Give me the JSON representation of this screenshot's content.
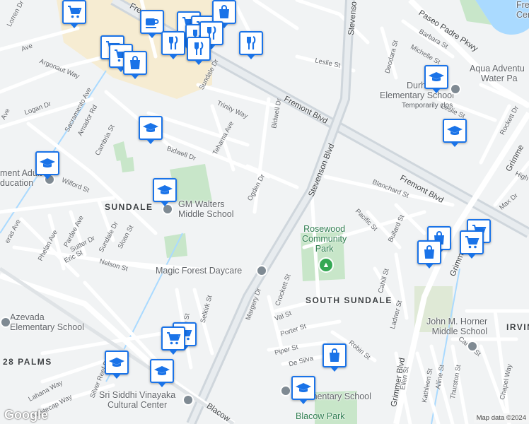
{
  "neighborhoods": {
    "sundale": "SUNDALE",
    "south_sundale": "SOUTH SUNDALE",
    "twenty_eight_palms": "28 PALMS",
    "irvington": "IRVIN"
  },
  "roads": {
    "fremont_blvd_1": "Fremont Blvd",
    "fremont_blvd_2": "Fremont Blvd",
    "fremont_blvd_top": "Fremo",
    "stevenson_blvd": "Stevenson Blvd",
    "stevenson_top": "Stevenso",
    "paseo_padre": "Paseo Padre Pkwy",
    "grimmer_blvd": "Grimmer Blvd",
    "grimmer_bottom": "Grimmer Blvd",
    "grimmer_top": "Grimme",
    "blacow": "Blacow",
    "argonaut": "Argonaut Way",
    "sacramento": "Sacramento Ave",
    "logan": "Logan Dr",
    "amador": "Amador Rd",
    "cambria": "Cambria St",
    "bidwell_dr": "Bidwell Dr",
    "bidwell_dr_2": "Bidwell Dr",
    "tehama": "Tehama Ave",
    "trinity": "Trinity Way",
    "sundale_dr_top": "Sundale Dr",
    "sundale_dr": "Sundale Dr",
    "ogden": "Ogden Dr",
    "wilford": "Wilford St",
    "pardee": "Pardee Ave",
    "phelan": "Phelan Ave",
    "sutter": "Sutter Dr",
    "eric": "Eric St",
    "sloan": "Sloan St",
    "nelson": "Nelson St",
    "alvarado": "eras Ave",
    "lorren": "Lorren Dr",
    "a_ave": "Ave",
    "leslie_top": "Leslie St",
    "leslie_right": "Leslie St",
    "barbara": "Barbara St",
    "michelle": "Michelle St",
    "deodara": "Deodara St",
    "rockett": "Rockett Dr",
    "high": "High",
    "max": "Max Dr",
    "blanchard": "Blanchard St",
    "pacific": "Pacific St",
    "bullard": "Bullard St",
    "cahill": "Cahill St",
    "ladner": "Ladner St",
    "margery": "Margery Dr",
    "crockett": "Crockett St",
    "val": "Val St",
    "porter": "Porter St",
    "piper": "Piper St",
    "de_silva": "De Silva",
    "robin": "Robin St",
    "caren": "Caren St",
    "thurston": "Thurston St",
    "alline": "Alline St",
    "kathleen": "Kathleen St",
    "ellen": "Ellen St",
    "chapel": "Chapel Way",
    "lahana": "Lahana Way",
    "whitecap": "Whitecap Way",
    "silver_reef": "Silver Reef Dr",
    "sidbarh": "Sidbarh St",
    "selkirk": "Selkirk St"
  },
  "places": {
    "walters": "GM Walters\nMiddle School",
    "magic_forest": "Magic Forest Daycare",
    "rosewood": "Rosewood\nCommunity\nPark",
    "durham": "Durh",
    "durham_2": "Elementary School",
    "durham_3": "Temporarily clos",
    "aqua": "Aqua Adventu",
    "aqua_2": "Water Pa",
    "horner": "John M. Horner\nMiddle School",
    "azevada": "Azevada\nElementary School",
    "siddhi": "Sri Siddhi Vinayaka\nCultural Center",
    "blacow_elem": "ow\nElementary School",
    "blacow_park": "Blacow Park",
    "fremont_adult": "ment Adult S\nducation",
    "central_park": "Fre\nCentr"
  },
  "icons": [
    "shopping-cart-icon",
    "shopping-bag-icon",
    "cafe-icon",
    "restaurant-icon",
    "school-icon"
  ],
  "footer": {
    "logo": "Google",
    "attribution": "Map data ©2024"
  },
  "colors": {
    "background": "#f1f3f4",
    "road": "#ffffff",
    "highway": "#cfd6dc",
    "park": "#c8e6c9",
    "commercial": "#f6ecd2",
    "water": "#aadaff",
    "pin_border": "#1a73e8"
  }
}
